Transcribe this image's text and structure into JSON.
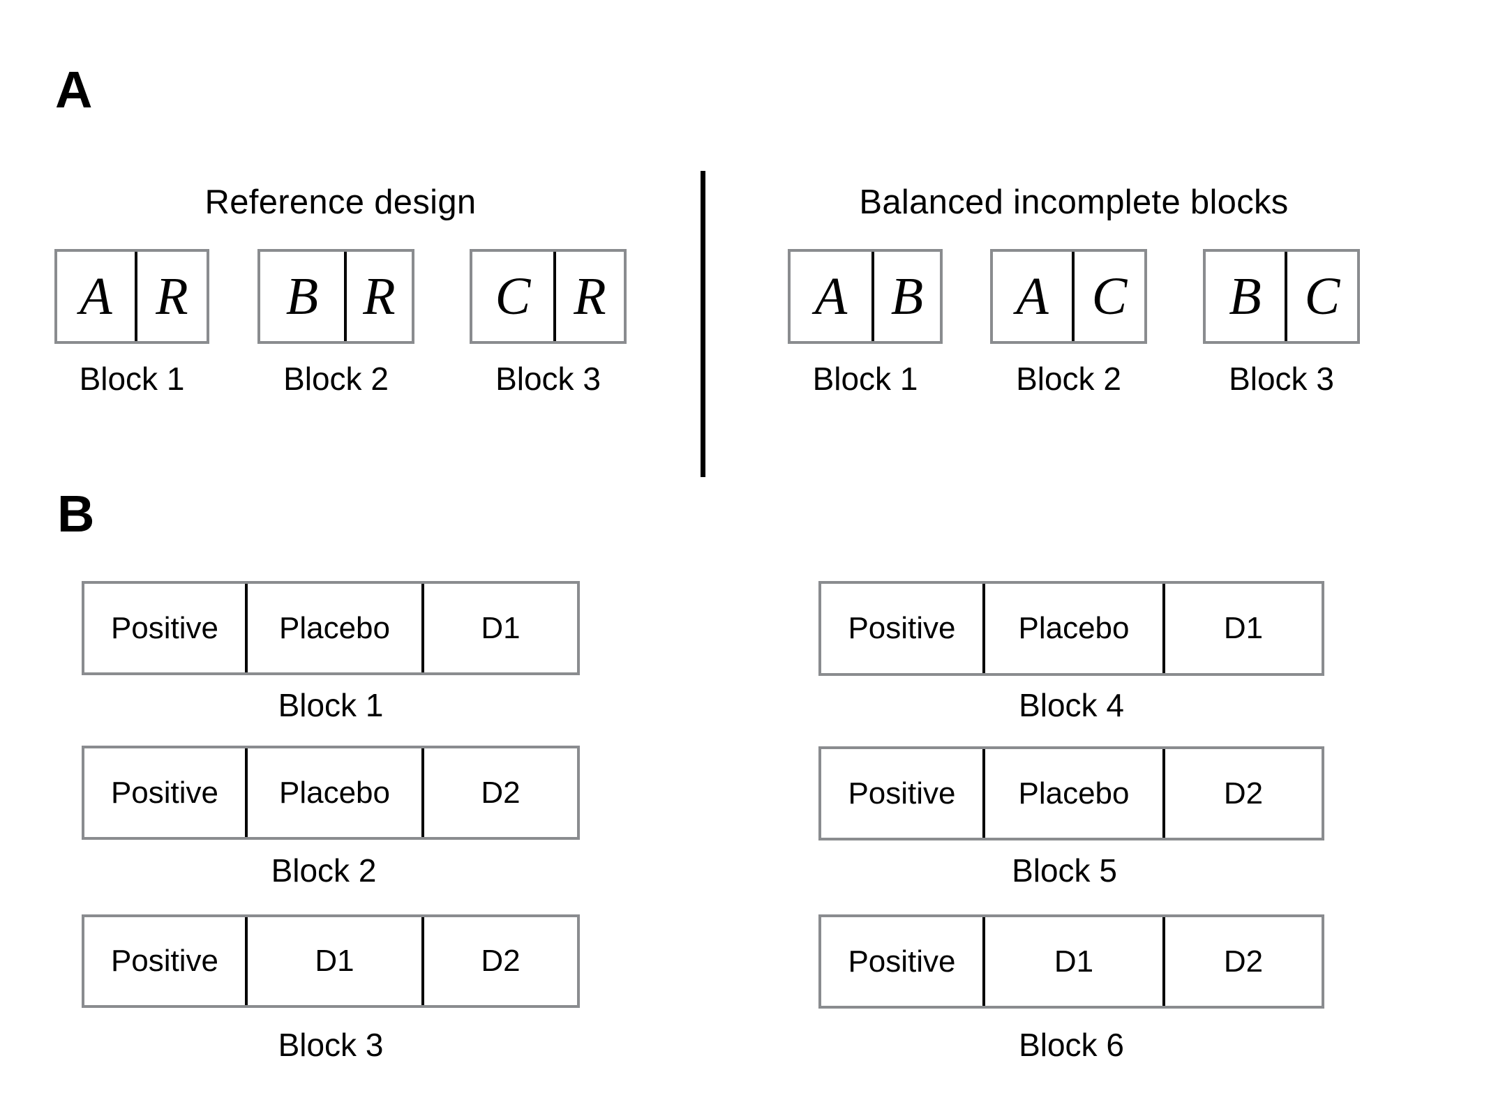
{
  "panel_a": {
    "label": "A",
    "reference_design": {
      "title": "Reference design",
      "blocks": [
        {
          "label": "Block 1",
          "cells": [
            "A",
            "R"
          ]
        },
        {
          "label": "Block 2",
          "cells": [
            "B",
            "R"
          ]
        },
        {
          "label": "Block 3",
          "cells": [
            "C",
            "R"
          ]
        }
      ]
    },
    "balanced_incomplete_blocks": {
      "title": "Balanced incomplete blocks",
      "blocks": [
        {
          "label": "Block 1",
          "cells": [
            "A",
            "B"
          ]
        },
        {
          "label": "Block 2",
          "cells": [
            "A",
            "C"
          ]
        },
        {
          "label": "Block 3",
          "cells": [
            "B",
            "C"
          ]
        }
      ]
    }
  },
  "panel_b": {
    "label": "B",
    "left_column": [
      {
        "label": "Block 1",
        "cells": [
          "Positive",
          "Placebo",
          "D1"
        ]
      },
      {
        "label": "Block 2",
        "cells": [
          "Positive",
          "Placebo",
          "D2"
        ]
      },
      {
        "label": "Block 3",
        "cells": [
          "Positive",
          "D1",
          "D2"
        ]
      }
    ],
    "right_column": [
      {
        "label": "Block 4",
        "cells": [
          "Positive",
          "Placebo",
          "D1"
        ]
      },
      {
        "label": "Block 5",
        "cells": [
          "Positive",
          "Placebo",
          "D2"
        ]
      },
      {
        "label": "Block 6",
        "cells": [
          "Positive",
          "D1",
          "D2"
        ]
      }
    ]
  },
  "colors": {
    "box_border": "#8a8c8f",
    "divider": "#000000",
    "text": "#000000"
  }
}
